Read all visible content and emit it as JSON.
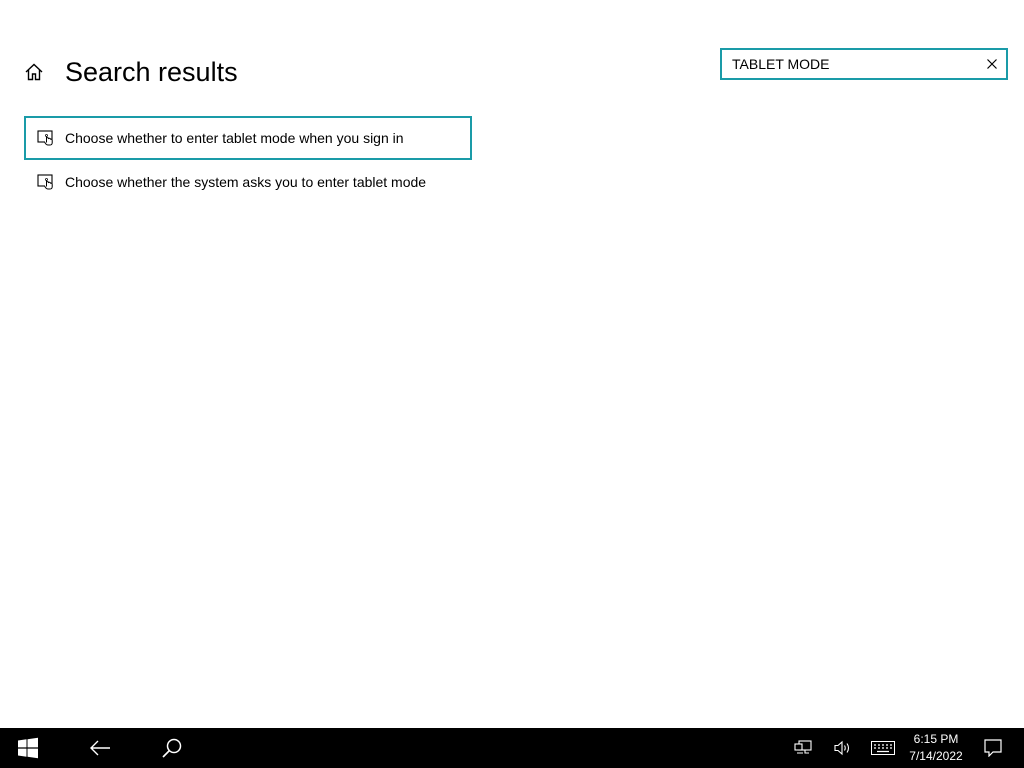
{
  "header": {
    "title": "Search results",
    "home_icon": "home-icon"
  },
  "search": {
    "value": "TABLET MODE",
    "clear_icon": "close-icon"
  },
  "results": [
    {
      "label": "Choose whether to enter tablet mode when you sign in",
      "icon": "tablet-touch-icon",
      "selected": true
    },
    {
      "label": "Choose whether the system asks you to enter tablet mode",
      "icon": "tablet-touch-icon",
      "selected": false
    }
  ],
  "taskbar": {
    "start_icon": "windows-logo-icon",
    "back_icon": "back-arrow-icon",
    "search_icon": "search-icon",
    "tray": {
      "network_icon": "network-icon",
      "volume_icon": "volume-icon",
      "keyboard_icon": "touch-keyboard-icon",
      "notification_icon": "action-center-icon"
    },
    "clock": {
      "time": "6:15 PM",
      "date": "7/14/2022"
    }
  },
  "colors": {
    "accent": "#1a9ba8",
    "background": "#ffffff",
    "taskbar": "#000000"
  }
}
